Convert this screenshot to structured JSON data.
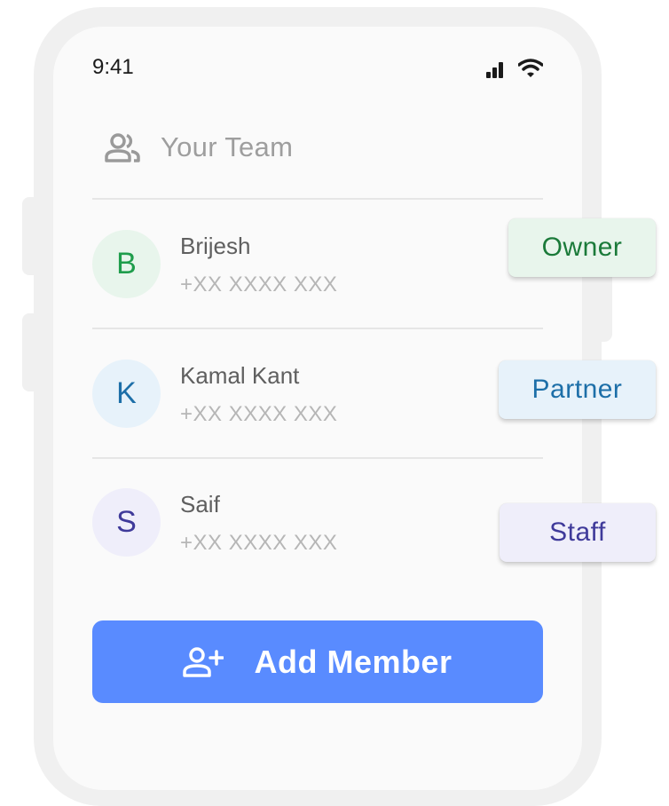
{
  "status_bar": {
    "time": "9:41"
  },
  "header": {
    "title": "Your Team",
    "icon": "team-icon"
  },
  "members": [
    {
      "initial": "B",
      "name": "Brijesh",
      "phone": "+XX XXXX XXX",
      "role": "Owner",
      "avatar_bg": "#e8f5ec",
      "avatar_fg": "#1f9d4c",
      "badge_bg": "#e8f5ec",
      "badge_fg": "#1b7a3a"
    },
    {
      "initial": "K",
      "name": "Kamal Kant",
      "phone": "+XX XXXX XXX",
      "role": "Partner",
      "avatar_bg": "#e7f2fa",
      "avatar_fg": "#1d6fa8",
      "badge_bg": "#e7f2fa",
      "badge_fg": "#1d6fa8"
    },
    {
      "initial": "S",
      "name": "Saif",
      "phone": "+XX XXXX XXX",
      "role": "Staff",
      "avatar_bg": "#efeefa",
      "avatar_fg": "#3f3a9a",
      "badge_bg": "#efeefa",
      "badge_fg": "#3f3a9a"
    }
  ],
  "add_member": {
    "label": "Add Member",
    "icon": "add-person-icon",
    "bg": "#598bff"
  }
}
